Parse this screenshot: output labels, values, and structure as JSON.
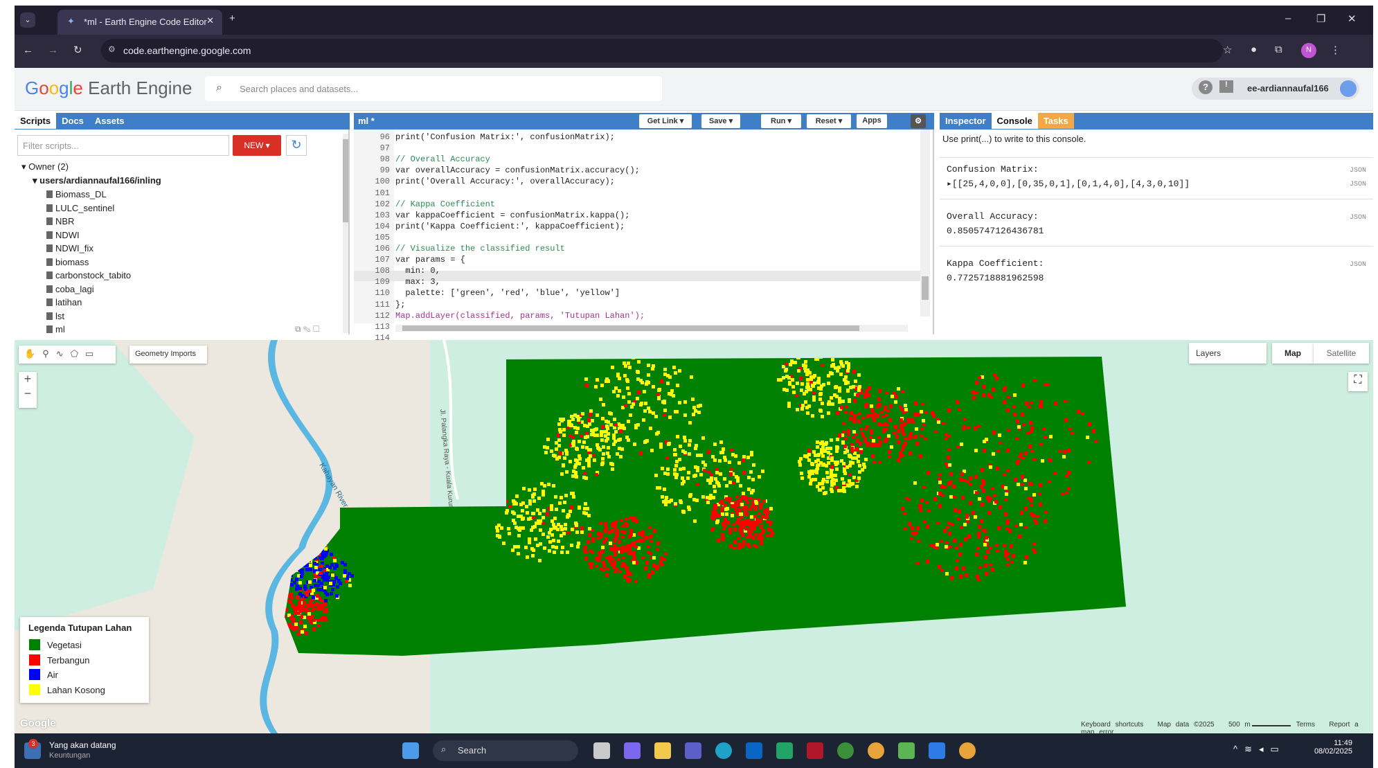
{
  "browser": {
    "tab_title": "*ml - Earth Engine Code Editor",
    "url": "code.earthengine.google.com",
    "profile": "N"
  },
  "header": {
    "logo_google": [
      "G",
      "o",
      "o",
      "g",
      "l",
      "e"
    ],
    "logo_rest": " Earth Engine",
    "search_placeholder": "Search places and datasets...",
    "user": "ee-ardiannaufal166"
  },
  "left": {
    "tabs": [
      "Scripts",
      "Docs",
      "Assets"
    ],
    "filter_placeholder": "Filter scripts...",
    "new_label": "NEW",
    "owner": "Owner (2)",
    "repo": "users/ardiannaufal166/inling",
    "files": [
      "Biomass_DL",
      "LULC_sentinel",
      "NBR",
      "NDWI",
      "NDWI_fix",
      "biomass",
      "carbonstock_tabito",
      "coba_lagi",
      "latihan",
      "lst",
      "ml"
    ]
  },
  "editor": {
    "title": "ml *",
    "buttons": [
      "Get Link",
      "Save",
      "Run",
      "Reset",
      "Apps"
    ],
    "lines": [
      {
        "n": "96",
        "t": "print('Confusion Matrix:', confusionMatrix);"
      },
      {
        "n": "97",
        "t": ""
      },
      {
        "n": "98",
        "t": "// Overall Accuracy"
      },
      {
        "n": "99",
        "t": "var overallAccuracy = confusionMatrix.accuracy();"
      },
      {
        "n": "100",
        "t": "print('Overall Accuracy:', overallAccuracy);"
      },
      {
        "n": "101",
        "t": ""
      },
      {
        "n": "102",
        "t": "// Kappa Coefficient"
      },
      {
        "n": "103",
        "t": "var kappaCoefficient = confusionMatrix.kappa();"
      },
      {
        "n": "104",
        "t": "print('Kappa Coefficient:', kappaCoefficient);"
      },
      {
        "n": "105",
        "t": ""
      },
      {
        "n": "106",
        "t": "// Visualize the classified result"
      },
      {
        "n": "107",
        "t": "var params = {"
      },
      {
        "n": "108",
        "t": "  min: 0,"
      },
      {
        "n": "109",
        "t": "  max: 3,"
      },
      {
        "n": "110",
        "t": "  palette: ['green', 'red', 'blue', 'yellow']"
      },
      {
        "n": "111",
        "t": "};"
      },
      {
        "n": "112",
        "t": "Map.addLayer(classified, params, 'Tutupan Lahan');"
      },
      {
        "n": "113",
        "t": ""
      },
      {
        "n": "114",
        "t": ""
      }
    ]
  },
  "console": {
    "tabs": [
      "Inspector",
      "Console",
      "Tasks"
    ],
    "hint": "Use print(...) to write to this console.",
    "entries": [
      {
        "label": "Confusion Matrix:",
        "value": "[[25,4,0,0],[0,35,0,1],[0,1,4,0],[4,3,0,10]]"
      },
      {
        "label": "Overall Accuracy:",
        "value": "0.8505747126436781"
      },
      {
        "label": "Kappa Coefficient:",
        "value": "0.7725718881962598"
      }
    ],
    "json_tag": "JSON"
  },
  "map": {
    "geometry_imports": "Geometry Imports",
    "layers": "Layers",
    "map_btn": "Map",
    "satellite_btn": "Satellite",
    "river": "Kahayan River",
    "road": "Jl. Palangka Raya - Kuala Kurun",
    "footer": [
      "Keyboard shortcuts",
      "Map data ©2025",
      "500 m",
      "Terms",
      "Report a map error"
    ],
    "attribution": "Google",
    "legend": {
      "title": "Legenda Tutupan Lahan",
      "items": [
        {
          "label": "Vegetasi",
          "color": "#008000"
        },
        {
          "label": "Terbangun",
          "color": "#ff0000"
        },
        {
          "label": "Air",
          "color": "#0000ff"
        },
        {
          "label": "Lahan Kosong",
          "color": "#ffff00"
        }
      ]
    }
  },
  "taskbar": {
    "news_title": "Yang akan datang",
    "news_sub": "Keuntungan",
    "news_badge": "3",
    "search": "Search",
    "time": "11:49",
    "date": "08/02/2025"
  }
}
